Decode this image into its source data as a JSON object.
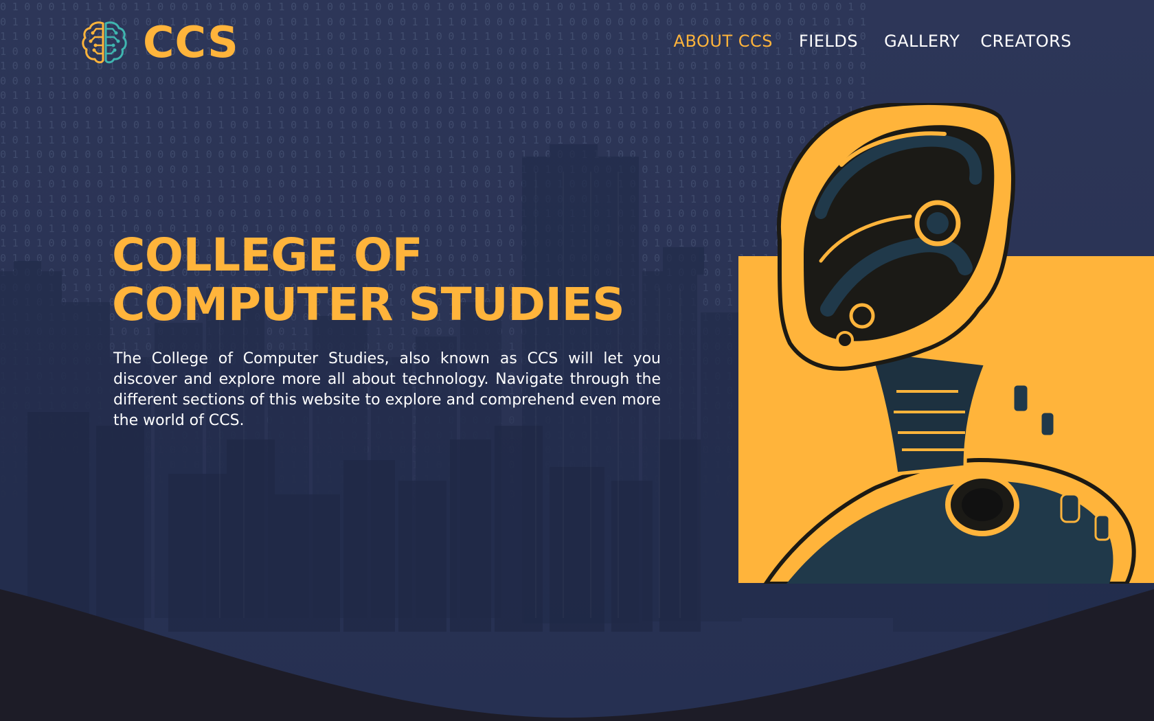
{
  "brand": {
    "name": "CCS",
    "logo_icon": "brain-circuit-icon"
  },
  "nav": {
    "items": [
      {
        "label": "ABOUT CCS",
        "active": true
      },
      {
        "label": "FIELDS",
        "active": false
      },
      {
        "label": "GALLERY",
        "active": false
      },
      {
        "label": "CREATORS",
        "active": false
      }
    ]
  },
  "hero": {
    "title_line1": "COLLEGE OF",
    "title_line2": "COMPUTER STUDIES",
    "description": "The College of Computer Studies, also known as CCS will let you discover and explore more all about technology. Navigate through the different sections of this website to explore and comprehend even more the world of CCS."
  },
  "illustration": {
    "name": "robot-portrait-illustration"
  },
  "colors": {
    "accent": "#ffb43b",
    "background": "#2c3556",
    "dark_wave": "#1d1c27",
    "logo_teal": "#3fb6b0"
  }
}
